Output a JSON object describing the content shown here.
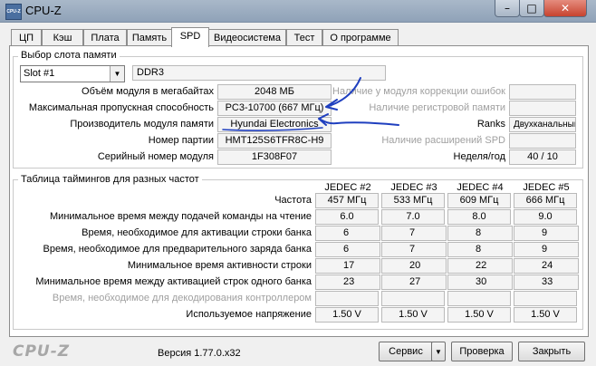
{
  "window": {
    "title": "CPU-Z",
    "icon_text": "CPU-Z",
    "min": "–",
    "max": "□",
    "close": "✕"
  },
  "tabs": [
    "ЦП",
    "Кэш",
    "Плата",
    "Память",
    "SPD",
    "Видеосистема",
    "Тест",
    "О программе"
  ],
  "active_tab": "SPD",
  "slot": {
    "group_label": "Выбор слота памяти",
    "selected": "Slot #1",
    "type": "DDR3",
    "left_labels": [
      "Объём модуля в мегабайтах",
      "Максимальная пропускная способность",
      "Производитель модуля памяти",
      "Номер партии",
      "Серийный номер модуля"
    ],
    "left_values": [
      "2048 МБ",
      "PC3-10700 (667 МГц)",
      "Hyundai Electronics",
      "HMT125S6TFR8C-H9",
      "1F308F07"
    ],
    "right_labels": [
      "Наличие у модуля коррекции ошибок",
      "Наличие регистровой памяти",
      "Ranks",
      "Наличие расширений SPD",
      "Неделя/год"
    ],
    "right_values": [
      "",
      "",
      "Двухканальный",
      "",
      "40 / 10"
    ]
  },
  "timings": {
    "group_label": "Таблица таймингов для разных частот",
    "headers": [
      "JEDEC #2",
      "JEDEC #3",
      "JEDEC #4",
      "JEDEC #5"
    ],
    "rows": [
      {
        "label": "Частота",
        "values": [
          "457 МГц",
          "533 МГц",
          "609 МГц",
          "666 МГц"
        ]
      },
      {
        "label": "Минимальное время между подачей команды на чтение",
        "values": [
          "6.0",
          "7.0",
          "8.0",
          "9.0"
        ]
      },
      {
        "label": "Время, необходимое для активации строки банка",
        "values": [
          "6",
          "7",
          "8",
          "9"
        ]
      },
      {
        "label": "Время, необходимое для предварительного заряда банка",
        "values": [
          "6",
          "7",
          "8",
          "9"
        ]
      },
      {
        "label": "Минимальное время активности строки",
        "values": [
          "17",
          "20",
          "22",
          "24"
        ]
      },
      {
        "label": "Минимальное время между активацией строк одного банка",
        "values": [
          "23",
          "27",
          "30",
          "33"
        ]
      },
      {
        "label": "Время, необходимое для декодирования контроллером",
        "values": [
          "",
          "",
          "",
          ""
        ]
      },
      {
        "label": "Используемое напряжение",
        "values": [
          "1.50 V",
          "1.50 V",
          "1.50 V",
          "1.50 V"
        ]
      }
    ]
  },
  "footer": {
    "logo": "CPU-Z",
    "version": "Версия 1.77.0.x32",
    "service_button": "Сервис",
    "check_button": "Проверка",
    "close_button": "Закрыть"
  },
  "colors": {
    "ink": "#1f3fbf",
    "titlebar": "#97a8bd",
    "close": "#c7432f"
  }
}
